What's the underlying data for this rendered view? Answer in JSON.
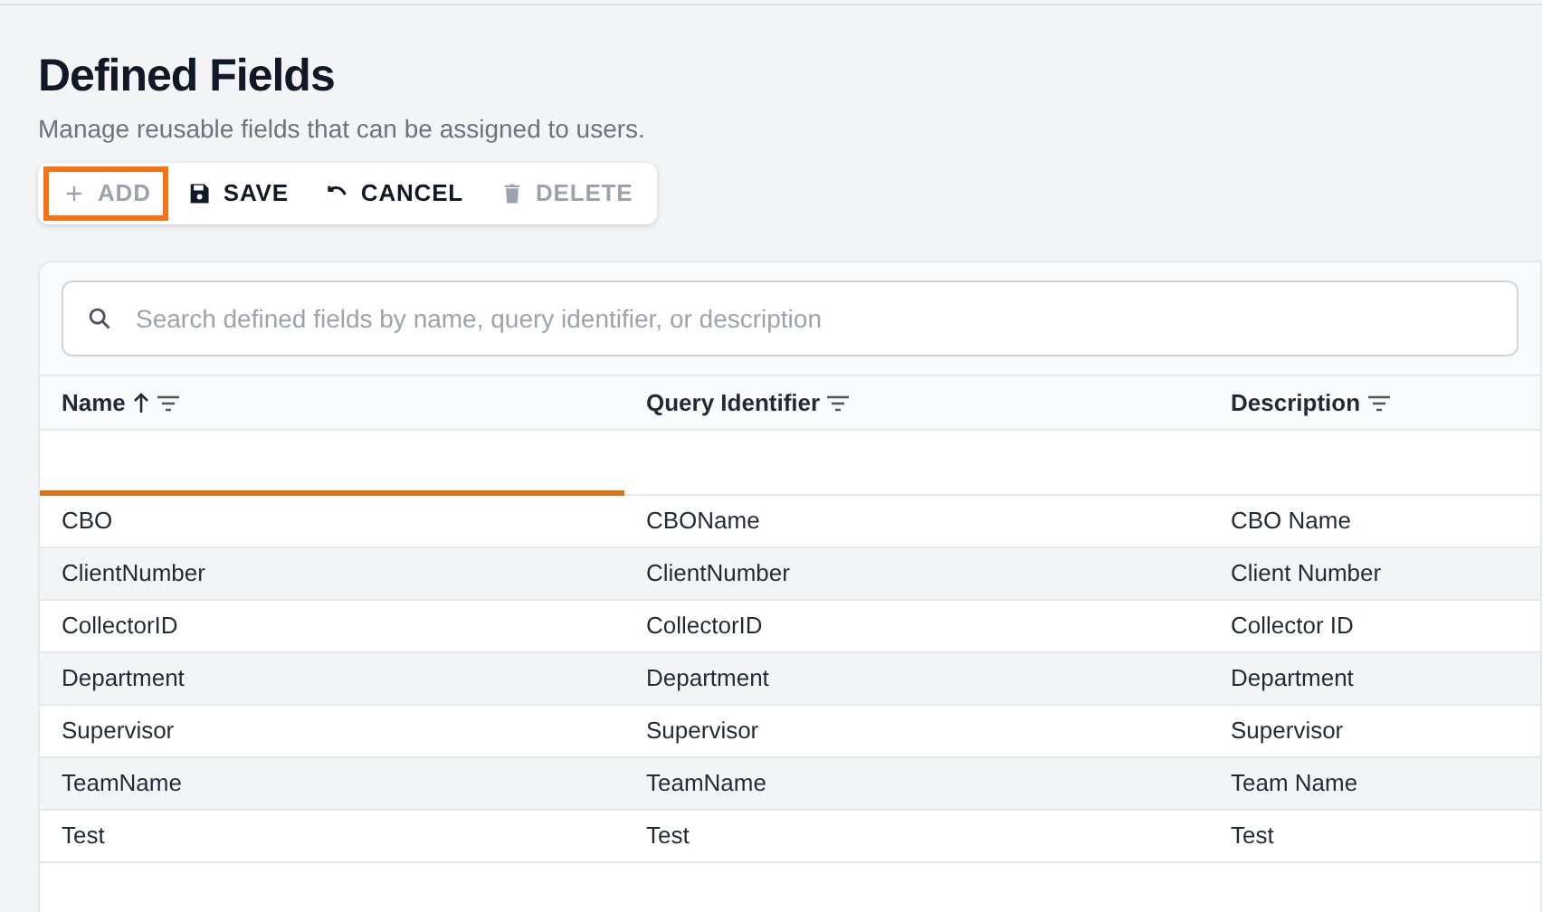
{
  "page": {
    "title": "Defined Fields",
    "subtitle": "Manage reusable fields that can be assigned to users."
  },
  "toolbar": [
    {
      "kind": "plus",
      "label": "ADD",
      "disabled": true,
      "focused": true
    },
    {
      "kind": "save",
      "label": "SAVE",
      "disabled": false,
      "focused": false
    },
    {
      "kind": "undo",
      "label": "CANCEL",
      "disabled": false,
      "focused": false
    },
    {
      "kind": "trash",
      "label": "DELETE",
      "disabled": true,
      "focused": false
    }
  ],
  "search": {
    "placeholder": "Search defined fields by name, query identifier, or description"
  },
  "table": {
    "columns": [
      {
        "label": "Name",
        "sorted_ascending": true
      },
      {
        "label": "Query Identifier",
        "sorted_ascending": false
      },
      {
        "label": "Description",
        "sorted_ascending": false
      }
    ],
    "name_filter": {
      "focused": true
    },
    "rows": [
      [
        "CBO",
        "CBOName",
        "CBO Name"
      ],
      [
        "ClientNumber",
        "ClientNumber",
        "Client Number"
      ],
      [
        "CollectorID",
        "CollectorID",
        "Collector ID"
      ],
      [
        "Department",
        "Department",
        "Department"
      ],
      [
        "Supervisor",
        "Supervisor",
        "Supervisor"
      ],
      [
        "TeamName",
        "TeamName",
        "Team Name"
      ],
      [
        "Test",
        "Test",
        "Test"
      ]
    ]
  }
}
